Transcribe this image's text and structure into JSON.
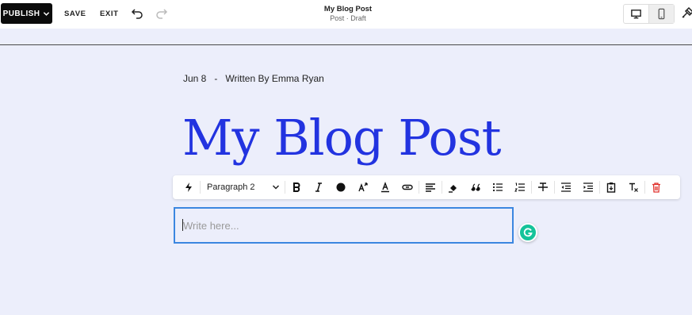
{
  "topbar": {
    "publish_label": "PUBLISH",
    "save_label": "SAVE",
    "exit_label": "EXIT",
    "doc_title": "My Blog Post",
    "doc_subtitle": "Post · Draft",
    "icons": [
      "chevron-down-icon",
      "undo-icon",
      "redo-icon",
      "desktop-icon",
      "mobile-icon",
      "paintbrush-icon"
    ]
  },
  "post": {
    "meta": "Jun 8   -   Written By Emma Ryan",
    "title": "My Blog Post"
  },
  "toolbar": {
    "block_style": "Paragraph 2",
    "icons": [
      "lightning-icon",
      "bold-icon",
      "italic-icon",
      "text-color-icon",
      "superscript-icon",
      "strikethrough-color-icon",
      "link-icon",
      "align-left-icon",
      "highlight-icon",
      "blockquote-icon",
      "bulleted-list-icon",
      "numbered-list-icon",
      "strikethrough-icon",
      "outdent-icon",
      "indent-icon",
      "paste-icon",
      "clear-format-icon",
      "trash-icon"
    ]
  },
  "editor": {
    "placeholder": "Write here..."
  },
  "colors": {
    "accent": "#2233e0",
    "focus_border": "#3b86e0",
    "canvas_bg": "#eceefb",
    "grammarly": "#15c39a",
    "delete": "#e0322d"
  }
}
